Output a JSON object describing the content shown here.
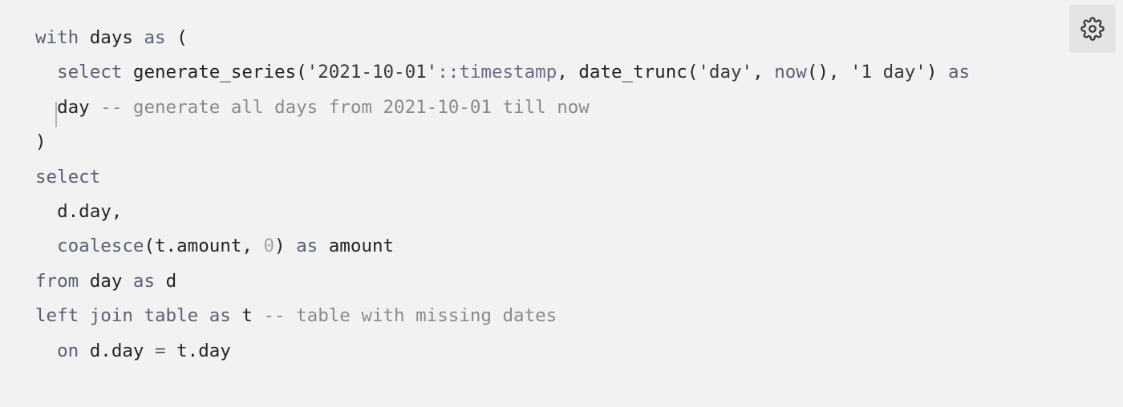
{
  "code_block": {
    "lines": [
      [
        {
          "t": "kw",
          "v": "with"
        },
        {
          "t": "punct",
          "v": " "
        },
        {
          "t": "id",
          "v": "days"
        },
        {
          "t": "punct",
          "v": " "
        },
        {
          "t": "kw",
          "v": "as"
        },
        {
          "t": "punct",
          "v": " ("
        }
      ],
      [
        {
          "t": "indent",
          "v": "  "
        },
        {
          "t": "kw",
          "v": "select"
        },
        {
          "t": "punct",
          "v": " "
        },
        {
          "t": "id",
          "v": "generate_series"
        },
        {
          "t": "punct",
          "v": "("
        },
        {
          "t": "str",
          "v": "'2021-10-01'"
        },
        {
          "t": "op",
          "v": "::"
        },
        {
          "t": "type",
          "v": "timestamp"
        },
        {
          "t": "punct",
          "v": ", "
        },
        {
          "t": "id",
          "v": "date_trunc"
        },
        {
          "t": "punct",
          "v": "("
        },
        {
          "t": "str",
          "v": "'day'"
        },
        {
          "t": "punct",
          "v": ", "
        },
        {
          "t": "fn",
          "v": "now"
        },
        {
          "t": "punct",
          "v": "(), "
        },
        {
          "t": "str",
          "v": "'1 day'"
        },
        {
          "t": "punct",
          "v": ") "
        },
        {
          "t": "kw",
          "v": "as"
        }
      ],
      [
        {
          "t": "indent",
          "v": "  "
        },
        {
          "t": "id",
          "v": "day",
          "cursor": true
        },
        {
          "t": "punct",
          "v": " "
        },
        {
          "t": "comment",
          "v": "-- generate all days from 2021-10-01 till now"
        }
      ],
      [
        {
          "t": "punct",
          "v": ")"
        }
      ],
      [
        {
          "t": "kw",
          "v": "select"
        }
      ],
      [
        {
          "t": "indent",
          "v": "  "
        },
        {
          "t": "id",
          "v": "d.day,"
        }
      ],
      [
        {
          "t": "indent",
          "v": "  "
        },
        {
          "t": "fn",
          "v": "coalesce"
        },
        {
          "t": "punct",
          "v": "(t.amount, "
        },
        {
          "t": "num",
          "v": "0"
        },
        {
          "t": "punct",
          "v": ") "
        },
        {
          "t": "kw",
          "v": "as"
        },
        {
          "t": "punct",
          "v": " "
        },
        {
          "t": "id",
          "v": "amount"
        }
      ],
      [
        {
          "t": "kw",
          "v": "from"
        },
        {
          "t": "punct",
          "v": " "
        },
        {
          "t": "id",
          "v": "day"
        },
        {
          "t": "punct",
          "v": " "
        },
        {
          "t": "kw",
          "v": "as"
        },
        {
          "t": "punct",
          "v": " "
        },
        {
          "t": "id",
          "v": "d"
        }
      ],
      [
        {
          "t": "kw",
          "v": "left join table as"
        },
        {
          "t": "punct",
          "v": " "
        },
        {
          "t": "id",
          "v": "t"
        },
        {
          "t": "punct",
          "v": " "
        },
        {
          "t": "comment",
          "v": "-- table with missing dates"
        }
      ],
      [
        {
          "t": "indent",
          "v": "  "
        },
        {
          "t": "kw",
          "v": "on"
        },
        {
          "t": "punct",
          "v": " "
        },
        {
          "t": "id",
          "v": "d.day"
        },
        {
          "t": "punct",
          "v": " "
        },
        {
          "t": "op",
          "v": "="
        },
        {
          "t": "punct",
          "v": " "
        },
        {
          "t": "id",
          "v": "t.day"
        }
      ]
    ]
  },
  "settings_button": {
    "icon": "gear-icon",
    "icon_color": "#3a3a3a"
  },
  "colors": {
    "background": "#f2f2f2",
    "button_background": "#e3e3e3",
    "text": "#242424",
    "keyword": "#5a6075",
    "comment": "#8a8a8a",
    "number": "#a3a3a3"
  }
}
